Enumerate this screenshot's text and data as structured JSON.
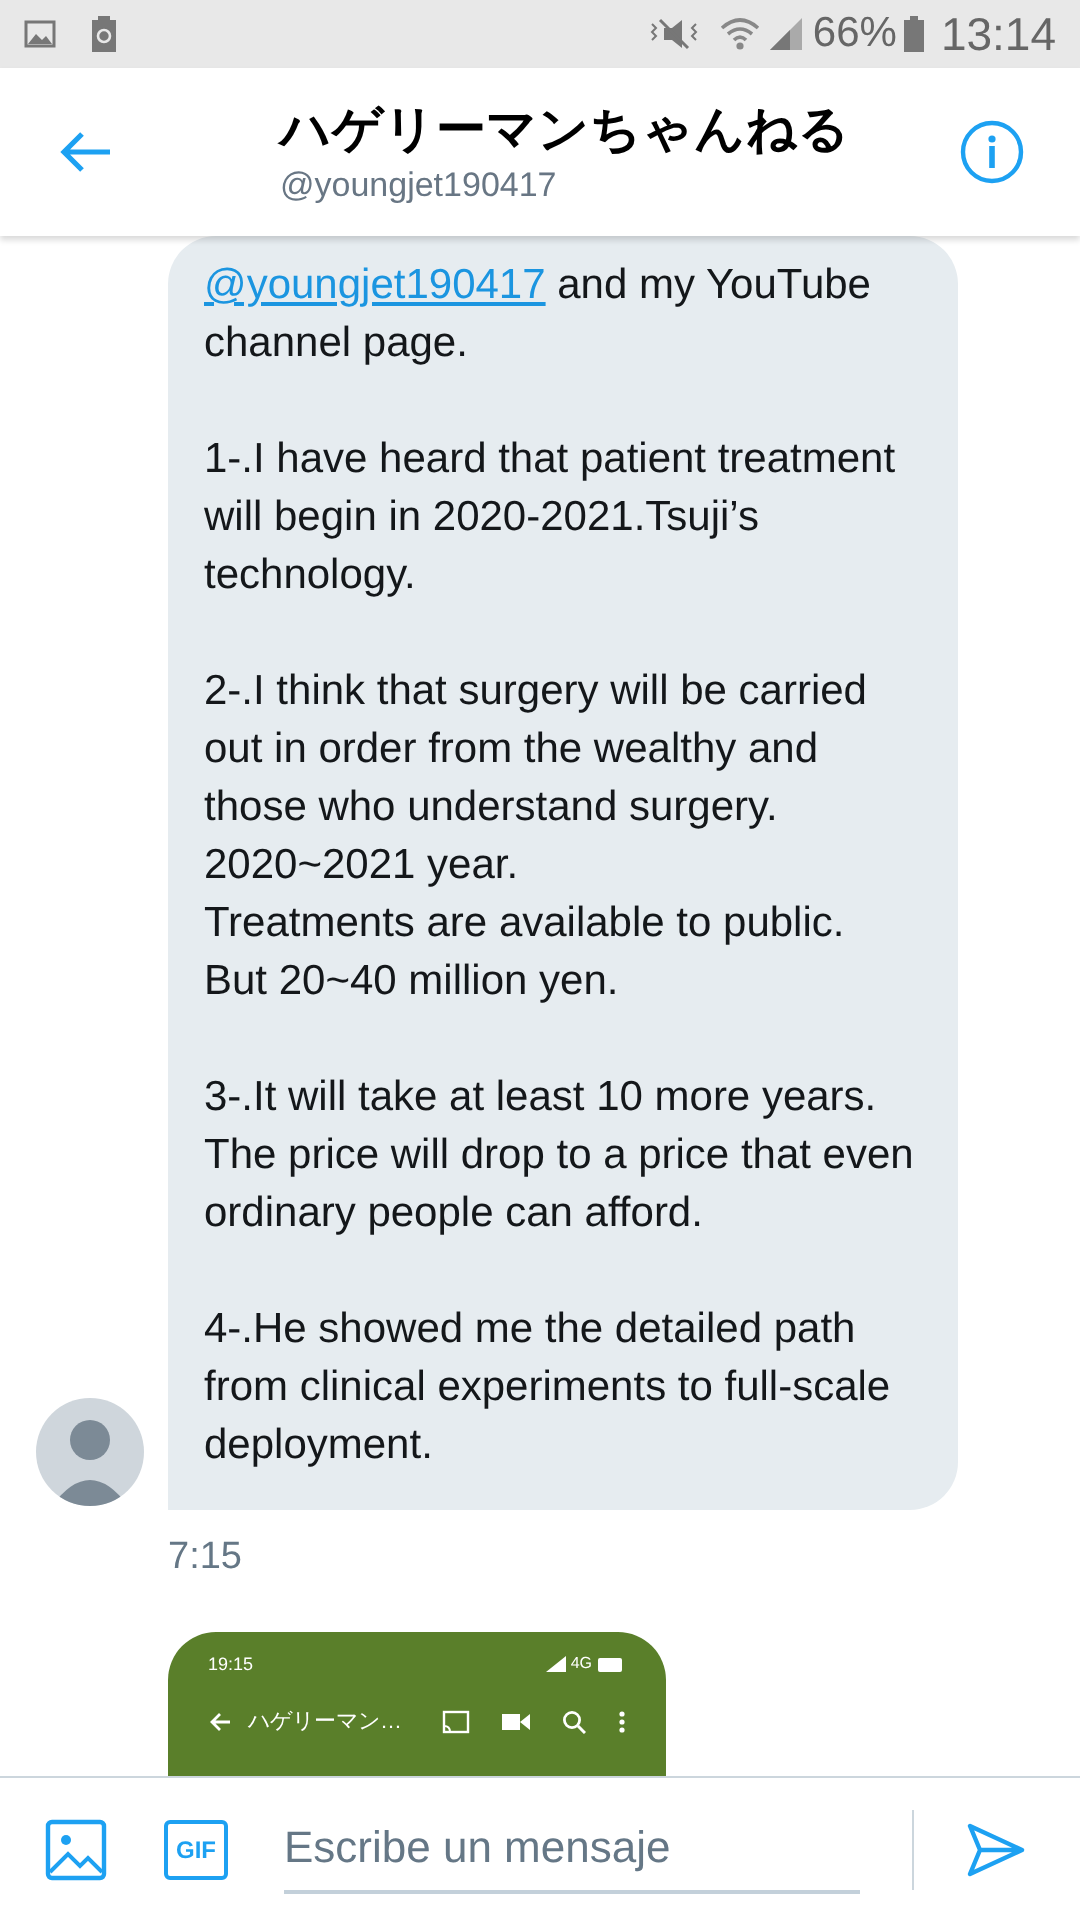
{
  "status_bar": {
    "battery": "66%",
    "time": "13:14"
  },
  "header": {
    "title": "ハゲリーマンちゃんねる",
    "handle": "@youngjet190417"
  },
  "message": {
    "link": "@youngjet190417",
    "first_line_rest": " and my YouTube channel page.",
    "paragraphs": [
      "1-.I have heard that patient treatment will begin in 2020-2021.Tsuji’s technology.",
      "2-.I think that surgery will be carried out in order from the wealthy and those who understand surgery.\n2020~2021 year.\nTreatments are available to public.\nBut 20~40 million yen.",
      "3-.It will take at least 10 more years. The price will drop to a price that even ordinary people can afford.",
      "4-.He showed me the detailed path from clinical experiments to full-scale deployment."
    ],
    "time": "7:15"
  },
  "attachment": {
    "time": "19:15",
    "network": "4G",
    "title": "ハゲリーマン…"
  },
  "composer": {
    "gif": "GIF",
    "placeholder": "Escribe un mensaje"
  }
}
